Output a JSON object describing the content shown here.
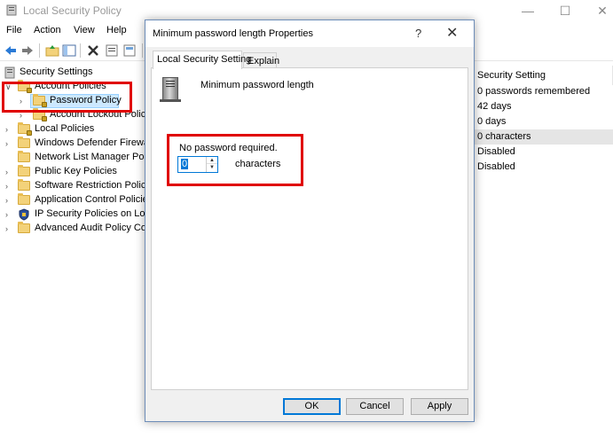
{
  "window": {
    "title": "Local Security Policy",
    "minimize": "—",
    "maximize": "☐",
    "close": "✕"
  },
  "menu": [
    "File",
    "Action",
    "View",
    "Help"
  ],
  "toolbar": {
    "icons": [
      "back-icon",
      "forward-icon",
      "up-folder-icon",
      "show-tree-icon",
      "delete-icon",
      "properties-icon",
      "export-icon",
      "help-icon"
    ]
  },
  "tree": {
    "root": "Security Settings",
    "items": [
      {
        "label": "Account Policies"
      },
      {
        "label": "Password Policy"
      },
      {
        "label": "Account Lockout Polic"
      },
      {
        "label": "Local Policies"
      },
      {
        "label": "Windows Defender Firewa"
      },
      {
        "label": "Network List Manager Poli"
      },
      {
        "label": "Public Key Policies"
      },
      {
        "label": "Software Restriction Policie"
      },
      {
        "label": "Application Control Policie"
      },
      {
        "label": "IP Security Policies on Loca"
      },
      {
        "label": "Advanced Audit Policy Co"
      }
    ]
  },
  "right_pane": {
    "column_header": "Security Setting",
    "values": [
      "0 passwords remembered",
      "42 days",
      "0 days",
      "0 characters",
      "Disabled",
      "Disabled"
    ]
  },
  "dialog": {
    "title": "Minimum password length Properties",
    "help": "?",
    "close": "✕",
    "tabs": [
      "Local Security Setting",
      "Explain"
    ],
    "setting_name": "Minimum password length",
    "status_text": "No password required.",
    "length_value": "0",
    "unit_label": "characters",
    "buttons": {
      "ok": "OK",
      "cancel": "Cancel",
      "apply": "Apply"
    }
  },
  "colors": {
    "highlight_red": "#e00000",
    "selection_blue": "#0078d7",
    "tree_selected": "#cce8ff"
  }
}
